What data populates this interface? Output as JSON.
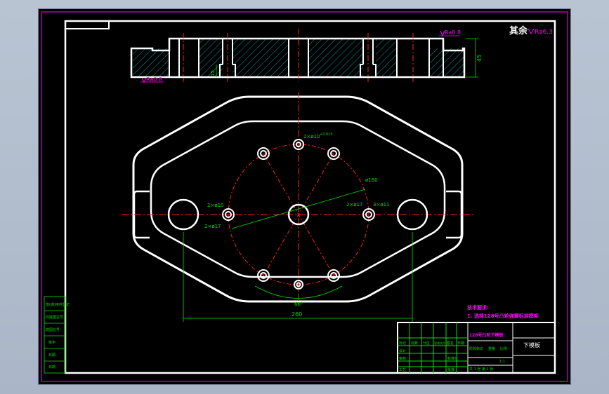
{
  "roughness": {
    "general_prefix": "其余",
    "general_value": "Ra6.3",
    "top_surface": "Ra0.8",
    "bottom_surface": "Ra0.8"
  },
  "dimensions": {
    "thickness": "45",
    "slot_depth": "15",
    "bolt_holes": "2×ø10",
    "bolt_hole_tol": "+0.015",
    "pcd": "ø160",
    "left_hole_a": "2×ø10",
    "left_hole_b": "2×ø17",
    "right_hole_a": "2×ø17",
    "right_hole_b": "3×ø11",
    "angle": "60°",
    "center_span": "260"
  },
  "notes": {
    "title": "技术要求:",
    "line1": "1. 选择128号凸轮弹簧标准模架"
  },
  "left_strip": {
    "rows": [
      "借(通)用件登记",
      "旧底图总号",
      "底图总号",
      "签字",
      "日期",
      "日期"
    ]
  },
  "title_block": {
    "drawing_name": "128号凸轮下模板",
    "part_name": "下模板",
    "scale_label": "比例",
    "scale_value": "1:1",
    "stage_labels": [
      "阶段标记",
      "重量",
      "比例"
    ],
    "sheet_info": "共 1 张 第 1 张",
    "sign_rows": [
      "设计",
      "审核",
      "工艺"
    ],
    "sign_cols": [
      "标记",
      "处数",
      "分区",
      "更改文件号",
      "签名",
      "日期"
    ],
    "approve_rows": [
      "标准化",
      "批准"
    ]
  },
  "colors": {
    "outline": "#ffffff",
    "center": "#ff2020",
    "dimension": "#00e000",
    "hatch": "#00c8d4",
    "border": "#ff00ff",
    "note": "#ff00ff"
  }
}
